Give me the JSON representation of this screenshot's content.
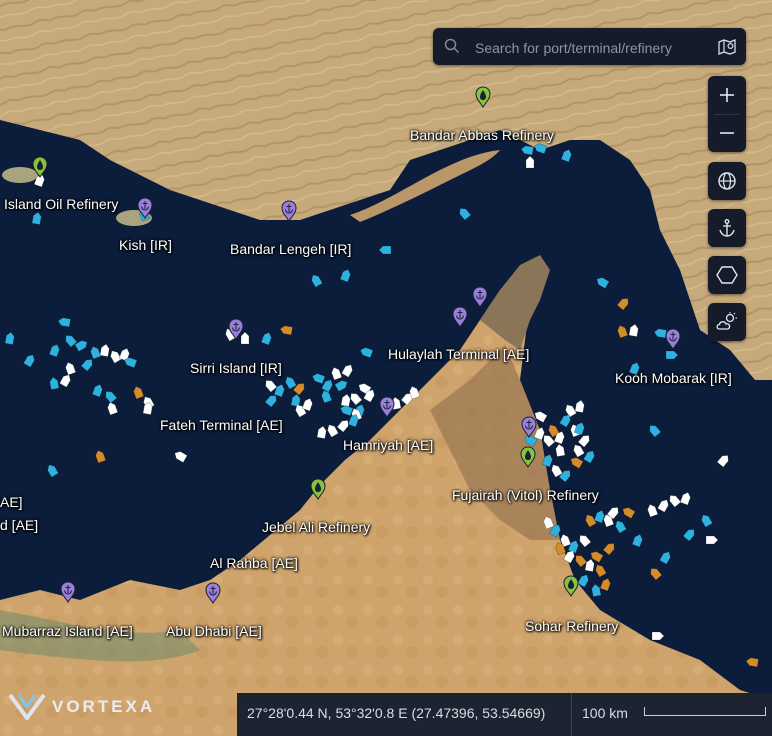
{
  "search": {
    "placeholder": "Search for port/terminal/refinery"
  },
  "places": [
    {
      "id": "bandar-abbas-refinery",
      "label": "Bandar Abbas Refinery"
    },
    {
      "id": "island-oil-refinery",
      "label": "Island Oil Refinery"
    },
    {
      "id": "kish",
      "label": "Kish [IR]"
    },
    {
      "id": "bandar-lengeh",
      "label": "Bandar Lengeh [IR]"
    },
    {
      "id": "sirri-island",
      "label": "Sirri Island [IR]"
    },
    {
      "id": "hulaylah-terminal",
      "label": "Hulaylah Terminal [AE]"
    },
    {
      "id": "kooh-mobarak",
      "label": "Kooh Mobarak [IR]"
    },
    {
      "id": "fateh-terminal",
      "label": "Fateh Terminal [AE]"
    },
    {
      "id": "hamriyah",
      "label": "Hamriyah [AE]"
    },
    {
      "id": "fujairah-vitol-refinery",
      "label": "Fujairah (Vitol) Refinery"
    },
    {
      "id": "jebel-ali-refinery",
      "label": "Jebel Ali Refinery"
    },
    {
      "id": "al-rahba",
      "label": "Al Rahba [AE]"
    },
    {
      "id": "mubarraz-island",
      "label": "Mubarraz Island [AE]"
    },
    {
      "id": "abu-dhabi",
      "label": "Abu Dhabi [AE]"
    },
    {
      "id": "sohar-refinery",
      "label": "Sohar Refinery"
    },
    {
      "id": "edge-ae-1",
      "label": "AE]"
    },
    {
      "id": "edge-ae-2",
      "label": "d [AE]"
    }
  ],
  "status": {
    "coordinates": "27°28'0.44 N, 53°32'0.8 E (27.47396, 53.54669)",
    "scale": "100 km"
  },
  "brand": {
    "name": "VORTEXA"
  },
  "colors": {
    "water": "#0b1d3a",
    "land": "#c8a877",
    "vessel_blue": "#2fb1e0",
    "vessel_orange": "#d48b2a",
    "vessel_white": "#ffffff",
    "port_pin": "#9b7fdc",
    "refinery_pin": "#86c440",
    "panel": "#151b29"
  },
  "controls": [
    "zoom-in-icon",
    "zoom-out-icon",
    "globe-icon",
    "anchor-icon",
    "hexagon-icon",
    "weather-icon"
  ]
}
